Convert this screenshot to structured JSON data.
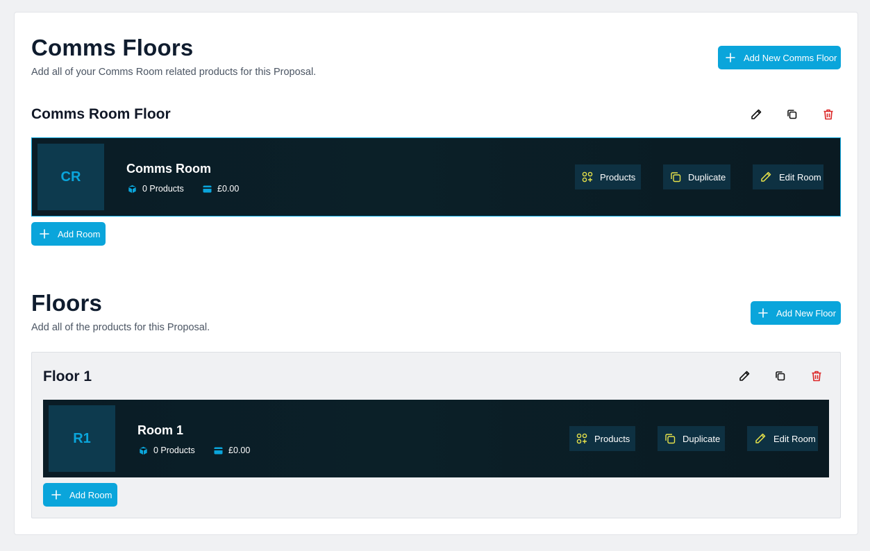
{
  "comms": {
    "title": "Comms Floors",
    "subtitle": "Add all of your Comms Room related products for this Proposal.",
    "add_button": "Add New Comms Floor",
    "floor": {
      "name": "Comms Room Floor",
      "room": {
        "initials": "CR",
        "name": "Comms Room",
        "products": "0 Products",
        "price": "£0.00",
        "btn_products": "Products",
        "btn_duplicate": "Duplicate",
        "btn_edit": "Edit Room"
      },
      "add_room": "Add Room"
    }
  },
  "floors": {
    "title": "Floors",
    "subtitle": "Add all of the products for this Proposal.",
    "add_button": "Add New Floor",
    "floor": {
      "name": "Floor 1",
      "room": {
        "initials": "R1",
        "name": "Room 1",
        "products": "0 Products",
        "price": "£0.00",
        "btn_products": "Products",
        "btn_duplicate": "Duplicate",
        "btn_edit": "Edit Room"
      },
      "add_room": "Add Room"
    }
  },
  "colors": {
    "accent": "#0aa5db",
    "delete": "#dc2626",
    "room_icon": "#e6e24a"
  }
}
